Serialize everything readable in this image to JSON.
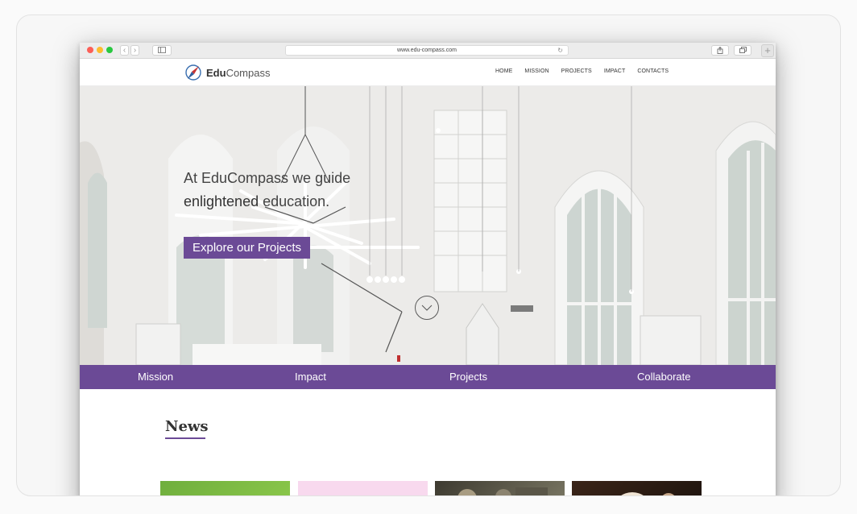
{
  "browser": {
    "url": "www.edu-compass.com"
  },
  "site": {
    "logo_bold": "Edu",
    "logo_rest": "Compass",
    "nav": [
      "HOME",
      "MISSION",
      "PROJECTS",
      "IMPACT",
      "CONTACTS"
    ]
  },
  "hero": {
    "line1": "At EduCompass we guide",
    "line2_bold": "enlightened",
    "line2_rest": " education.",
    "cta": "Explore our Projects"
  },
  "subnav": [
    "Mission",
    "Impact",
    "Projects",
    "Collaborate"
  ],
  "news": {
    "title": "News"
  },
  "colors": {
    "accent": "#6b4a96"
  }
}
